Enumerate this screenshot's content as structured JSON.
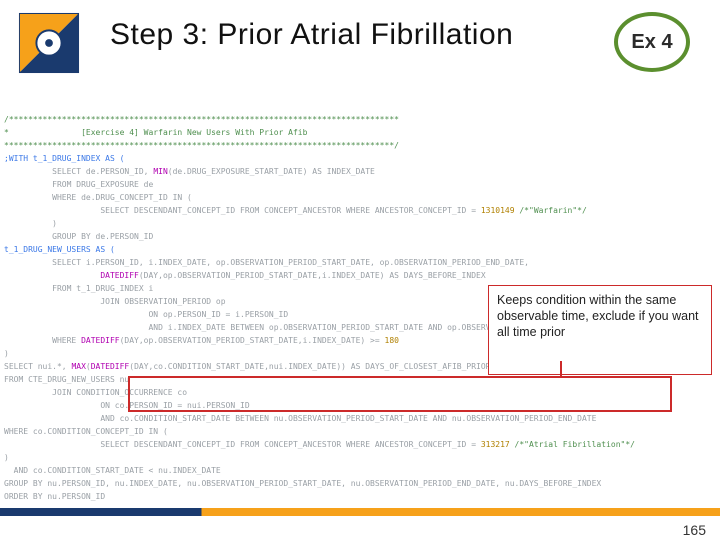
{
  "title": "Step 3: Prior Atrial Fibrillation",
  "badge": "Ex 4",
  "page": "165",
  "callout": "Keeps condition within the same observable time, exclude if you want all time prior",
  "code": {
    "l01": "/*********************************************************************************",
    "l02": "*               [Exercise 4] Warfarin New Users With Prior Afib",
    "l03": "*********************************************************************************/",
    "l04": ";WITH t_1_DRUG_INDEX AS (",
    "l05a": "          SELECT de.PERSON_ID, ",
    "l05b": "MIN",
    "l05c": "(de.DRUG_EXPOSURE_START_DATE) AS INDEX_DATE",
    "l06": "          FROM DRUG_EXPOSURE de",
    "l07": "          WHERE de.DRUG_CONCEPT_ID IN (",
    "l08a": "                    SELECT DESCENDANT_CONCEPT_ID FROM CONCEPT_ANCESTOR WHERE ANCESTOR_CONCEPT_ID = ",
    "l08b": "1310149",
    "l08c": " /*\"Warfarin\"*/",
    "l09": "          )",
    "l10": "          GROUP BY de.PERSON_ID",
    "l11": "t_1_DRUG_NEW_USERS AS (",
    "l12": "          SELECT i.PERSON_ID, i.INDEX_DATE, op.OBSERVATION_PERIOD_START_DATE, op.OBSERVATION_PERIOD_END_DATE,",
    "l13a": "                    ",
    "l13b": "DATEDIFF",
    "l13c": "(DAY,op.OBSERVATION_PERIOD_START_DATE,i.INDEX_DATE) AS DAYS_BEFORE_INDEX",
    "l14": "          FROM t_1_DRUG_INDEX i",
    "l15": "                    JOIN OBSERVATION_PERIOD op",
    "l16": "                              ON op.PERSON_ID = i.PERSON_ID",
    "l17": "                              AND i.INDEX_DATE BETWEEN op.OBSERVATION_PERIOD_START_DATE AND op.OBSERVATION_PERIOD_END_DATE",
    "l18a": "          WHERE ",
    "l18b": "DATEDIFF",
    "l18c": "(DAY,op.OBSERVATION_PERIOD_START_DATE,i.INDEX_DATE) >= ",
    "l18d": "180",
    "l19": ")",
    "l20a": "SELECT nui.*, ",
    "l20b": "MAX",
    "l20c": "(",
    "l20d": "DATEDIFF",
    "l20e": "(DAY,co.CONDITION_START_DATE,nui.INDEX_DATE)) AS DAYS_OF_CLOSEST_AFIB_PRIOR_TO_INDEX",
    "l21": "FROM CTE_DRUG_NEW_USERS nu",
    "l22": "          JOIN CONDITION_OCCURRENCE co",
    "l23": "                    ON co.PERSON_ID = nui.PERSON_ID",
    "l24": "                    AND co.CONDITION_START_DATE BETWEEN nu.OBSERVATION_PERIOD_START_DATE AND nu.OBSERVATION_PERIOD_END_DATE",
    "l25": "WHERE co.CONDITION_CONCEPT_ID IN (",
    "l26a": "                    SELECT DESCENDANT_CONCEPT_ID FROM CONCEPT_ANCESTOR WHERE ANCESTOR_CONCEPT_ID = ",
    "l26b": "313217",
    "l26c": " /*\"Atrial Fibrillation\"*/",
    "l27": ")",
    "l28": "  AND co.CONDITION_START_DATE < nu.INDEX_DATE",
    "l29": "GROUP BY nu.PERSON_ID, nu.INDEX_DATE, nu.OBSERVATION_PERIOD_START_DATE, nu.OBSERVATION_PERIOD_END_DATE, nu.DAYS_BEFORE_INDEX",
    "l30": "ORDER BY nu.PERSON_ID"
  }
}
